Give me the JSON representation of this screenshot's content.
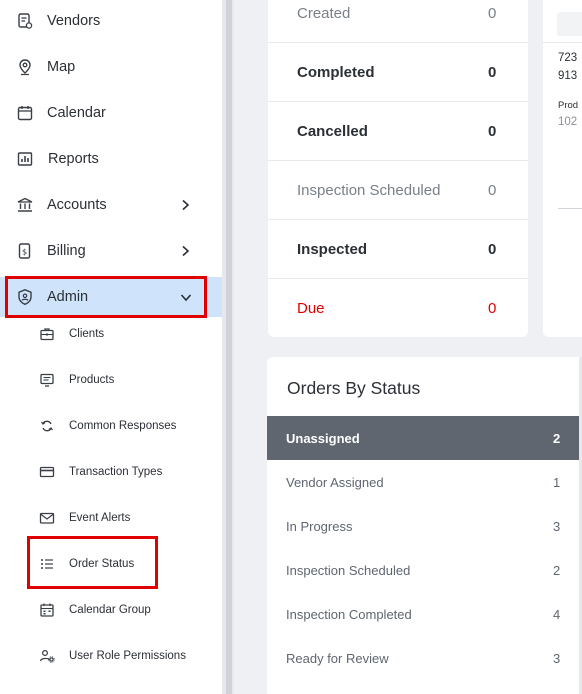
{
  "sidebar": {
    "items": [
      {
        "label": "Vendors",
        "icon": "vendor-list-icon"
      },
      {
        "label": "Map",
        "icon": "map-pin-icon"
      },
      {
        "label": "Calendar",
        "icon": "calendar-icon"
      },
      {
        "label": "Reports",
        "icon": "reports-icon"
      },
      {
        "label": "Accounts",
        "icon": "bank-icon"
      },
      {
        "label": "Billing",
        "icon": "billing-icon"
      },
      {
        "label": "Admin",
        "icon": "shield-user-icon"
      }
    ],
    "admin_sub_items": [
      {
        "label": "Clients",
        "icon": "briefcase-icon"
      },
      {
        "label": "Products",
        "icon": "products-icon"
      },
      {
        "label": "Common Responses",
        "icon": "refresh-icon"
      },
      {
        "label": "Transaction Types",
        "icon": "credit-card-icon"
      },
      {
        "label": "Event Alerts",
        "icon": "mail-icon"
      },
      {
        "label": "Order Status",
        "icon": "list-icon"
      },
      {
        "label": "Calendar Group",
        "icon": "calendar-icon"
      },
      {
        "label": "User Role Permissions",
        "icon": "user-gear-icon"
      }
    ]
  },
  "status_counts": [
    {
      "name": "Created",
      "count": "0"
    },
    {
      "name": "Completed",
      "count": "0"
    },
    {
      "name": "Cancelled",
      "count": "0"
    },
    {
      "name": "Inspection Scheduled",
      "count": "0"
    },
    {
      "name": "Inspected",
      "count": "0"
    },
    {
      "name": "Due",
      "count": "0"
    }
  ],
  "right_card": {
    "line1": "723",
    "line2": "913",
    "prod_label": "Prod",
    "prod_value": "102"
  },
  "orders_by_status": {
    "title": "Orders By Status",
    "rows": [
      {
        "name": "Unassigned",
        "count": "2"
      },
      {
        "name": "Vendor Assigned",
        "count": "1"
      },
      {
        "name": "In Progress",
        "count": "3"
      },
      {
        "name": "Inspection Scheduled",
        "count": "2"
      },
      {
        "name": "Inspection Completed",
        "count": "4"
      },
      {
        "name": "Ready for Review",
        "count": "3"
      }
    ]
  },
  "colors": {
    "highlight_outline": "#e10000",
    "active_nav_bg": "#cfe3fb",
    "selected_row_bg": "#5f6670",
    "due_text": "#e10000"
  }
}
